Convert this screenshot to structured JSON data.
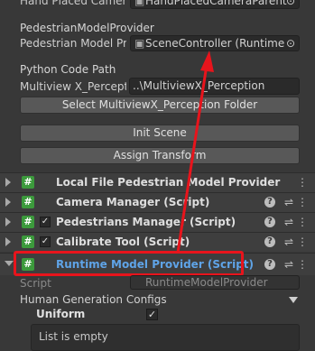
{
  "top": {
    "hand_label": "Hand Placed Camera",
    "hand_value": "HandPlacedCameraParent"
  },
  "pedestrian": {
    "header": "PedestrianModelProvider",
    "label": "Pedestrian Model Pr",
    "value": "SceneController (Runtime I"
  },
  "python": {
    "header": "Python Code Path",
    "label": "Multiview X_Percepti",
    "value": "..\\MultiviewX_Perception",
    "select_button": "Select MultiviewX_Perception Folder"
  },
  "buttons": {
    "init_scene": "Init Scene",
    "assign_transform": "Assign Transform"
  },
  "components": [
    {
      "label": "Local File Pedestrian Model Provider",
      "checkbox": false
    },
    {
      "label": "Camera Manager (Script)",
      "checkbox": false
    },
    {
      "label": "Pedestrians Manager (Script)",
      "checkbox": true
    },
    {
      "label": "Calibrate Tool (Script)",
      "checkbox": true
    },
    {
      "label": "Runtime Model Provider (Script)",
      "checkbox": false
    }
  ],
  "script_row": {
    "label": "Script",
    "value": "RuntimeModelProvider"
  },
  "human_configs": {
    "label": "Human Generation Configs",
    "uniform_label": "Uniform",
    "uniform_checked": true,
    "list_text": "List is empty"
  },
  "colors": {
    "highlight": "#e8141c",
    "accent": "#4a90d9",
    "script_green": "#3c9a3c"
  }
}
